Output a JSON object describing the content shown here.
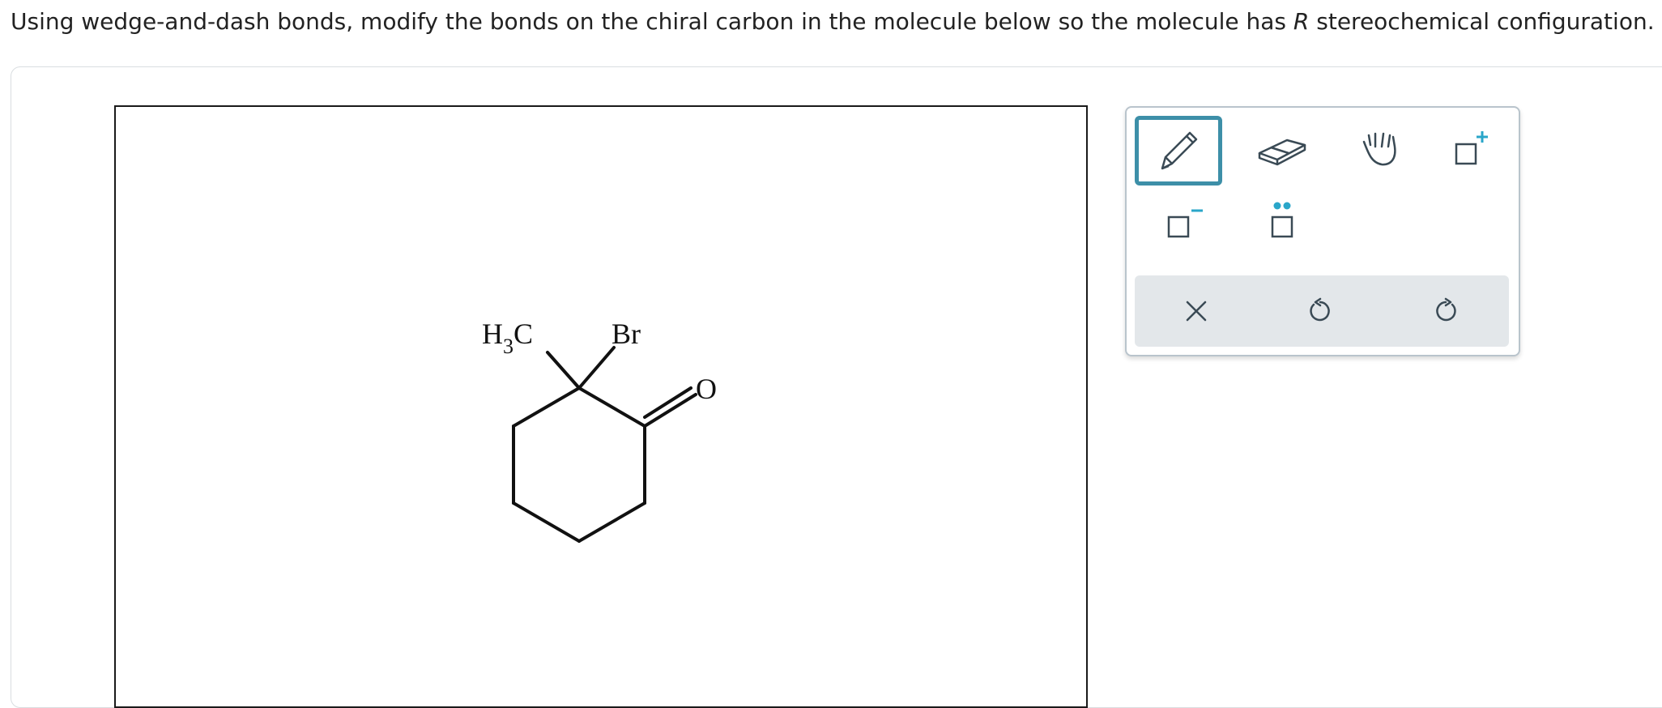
{
  "question": {
    "before_r": "Using wedge-and-dash bonds, modify the bonds on the chiral carbon in the molecule below so the molecule has ",
    "r_letter": "R",
    "after_r": " stereochemical configuration."
  },
  "molecule": {
    "methyl_H": "H",
    "methyl_sub": "3",
    "methyl_C": "C",
    "bromine": "Br",
    "oxygen": "O"
  },
  "toolbar": {
    "tools": [
      {
        "name": "pencil-tool",
        "icon": "pencil-icon",
        "selected": true
      },
      {
        "name": "eraser-tool",
        "icon": "eraser-icon",
        "selected": false
      },
      {
        "name": "hand-tool",
        "icon": "hand-icon",
        "selected": false
      },
      {
        "name": "positive-charge-tool",
        "icon": "positive-charge-icon",
        "selected": false
      },
      {
        "name": "negative-charge-tool",
        "icon": "negative-charge-icon",
        "selected": false
      },
      {
        "name": "lone-pair-tool",
        "icon": "lone-pair-icon",
        "selected": false
      }
    ],
    "actions": [
      {
        "name": "clear-button",
        "icon": "close-icon"
      },
      {
        "name": "undo-button",
        "icon": "undo-icon"
      },
      {
        "name": "redo-button",
        "icon": "redo-icon"
      }
    ],
    "colors": {
      "accent": "#3d8fa8",
      "icon": "#3a4a55",
      "charge": "#2aa6c9"
    }
  }
}
